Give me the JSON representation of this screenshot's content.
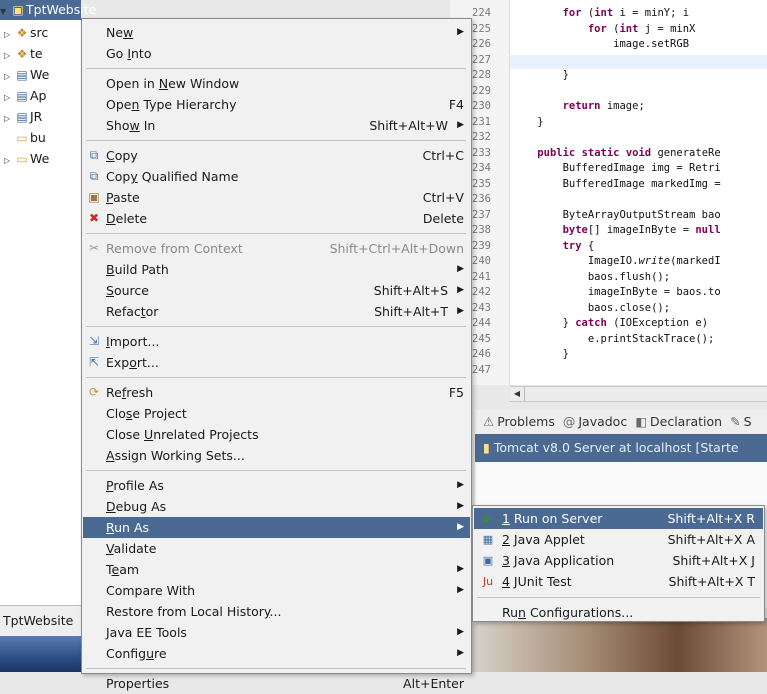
{
  "explorer": {
    "root": "TptWebsite",
    "items": [
      {
        "label": "src",
        "icon": "package-folder-icon"
      },
      {
        "label": "te",
        "icon": "package-folder-icon"
      },
      {
        "label": "We",
        "icon": "library-icon"
      },
      {
        "label": "Ap",
        "icon": "library-icon"
      },
      {
        "label": "JR",
        "icon": "library-icon"
      },
      {
        "label": "bu",
        "icon": "folder-icon"
      },
      {
        "label": "We",
        "icon": "folder-icon"
      }
    ],
    "bottom_label": "TptWebsite"
  },
  "editor": {
    "lines": [
      {
        "n": "224",
        "code": "        for (int i = minY; i"
      },
      {
        "n": "225",
        "code": "            for (int j = minX"
      },
      {
        "n": "226",
        "code": "                image.setRGB"
      },
      {
        "n": "227",
        "code": ""
      },
      {
        "n": "228",
        "code": "        }"
      },
      {
        "n": "229",
        "code": ""
      },
      {
        "n": "230",
        "code": "        return image;"
      },
      {
        "n": "231",
        "code": "    }"
      },
      {
        "n": "232",
        "code": ""
      },
      {
        "n": "233",
        "code": "    public static void generateRe"
      },
      {
        "n": "234",
        "code": "        BufferedImage img = Retri"
      },
      {
        "n": "235",
        "code": "        BufferedImage markedImg ="
      },
      {
        "n": "236",
        "code": ""
      },
      {
        "n": "237",
        "code": "        ByteArrayOutputStream bao"
      },
      {
        "n": "238",
        "code": "        byte[] imageInByte = null"
      },
      {
        "n": "239",
        "code": "        try {"
      },
      {
        "n": "240",
        "code": "            ImageIO.write(markedI"
      },
      {
        "n": "241",
        "code": "            baos.flush();"
      },
      {
        "n": "242",
        "code": "            imageInByte = baos.to"
      },
      {
        "n": "243",
        "code": "            baos.close();"
      },
      {
        "n": "244",
        "code": "        } catch (IOException e)"
      },
      {
        "n": "245",
        "code": "            e.printStackTrace();"
      },
      {
        "n": "246",
        "code": "        }"
      },
      {
        "n": "247",
        "code": ""
      }
    ]
  },
  "views": {
    "tabs": [
      {
        "label": "Problems",
        "icon": "problems-icon"
      },
      {
        "label": "Javadoc",
        "icon": "at-icon"
      },
      {
        "label": "Declaration",
        "icon": "declaration-icon"
      },
      {
        "label": "S",
        "icon": "snippet-icon"
      }
    ],
    "server": "Tomcat v8.0 Server at localhost  [Starte"
  },
  "menu": {
    "items": [
      {
        "label": "New",
        "u": "w",
        "shortcut": "",
        "submenu": true
      },
      {
        "label": "Go Into",
        "u": "I",
        "shortcut": ""
      },
      {
        "sep": true
      },
      {
        "label": "Open in New Window",
        "u": "N",
        "shortcut": ""
      },
      {
        "label": "Open Type Hierarchy",
        "u": "n",
        "shortcut": "F4"
      },
      {
        "label": "Show In",
        "u": "w",
        "shortcut": "Shift+Alt+W",
        "submenu": true
      },
      {
        "sep": true
      },
      {
        "label": "Copy",
        "u": "C",
        "shortcut": "Ctrl+C",
        "icon": "copy-icon"
      },
      {
        "label": "Copy Qualified Name",
        "u": "y",
        "shortcut": "",
        "icon": "copy-qualified-name-icon"
      },
      {
        "label": "Paste",
        "u": "P",
        "shortcut": "Ctrl+V",
        "icon": "paste-icon"
      },
      {
        "label": "Delete",
        "u": "D",
        "shortcut": "Delete",
        "icon": "delete-icon"
      },
      {
        "sep": true
      },
      {
        "label": "Remove from Context",
        "u": "",
        "shortcut": "Shift+Ctrl+Alt+Down",
        "icon": "remove-context-icon",
        "disabled": true
      },
      {
        "label": "Build Path",
        "u": "B",
        "shortcut": "",
        "submenu": true
      },
      {
        "label": "Source",
        "u": "S",
        "shortcut": "Shift+Alt+S",
        "submenu": true
      },
      {
        "label": "Refactor",
        "u": "t",
        "shortcut": "Shift+Alt+T",
        "submenu": true
      },
      {
        "sep": true
      },
      {
        "label": "Import...",
        "u": "I",
        "shortcut": "",
        "icon": "import-icon"
      },
      {
        "label": "Export...",
        "u": "o",
        "shortcut": "",
        "icon": "export-icon"
      },
      {
        "sep": true
      },
      {
        "label": "Refresh",
        "u": "f",
        "shortcut": "F5",
        "icon": "refresh-icon"
      },
      {
        "label": "Close Project",
        "u": "s",
        "shortcut": ""
      },
      {
        "label": "Close Unrelated Projects",
        "u": "U",
        "shortcut": ""
      },
      {
        "label": "Assign Working Sets...",
        "u": "A",
        "shortcut": ""
      },
      {
        "sep": true
      },
      {
        "label": "Profile As",
        "u": "P",
        "shortcut": "",
        "submenu": true
      },
      {
        "label": "Debug As",
        "u": "D",
        "shortcut": "",
        "submenu": true
      },
      {
        "label": "Run As",
        "u": "R",
        "shortcut": "",
        "submenu": true,
        "selected": true
      },
      {
        "label": "Validate",
        "u": "V",
        "shortcut": ""
      },
      {
        "label": "Team",
        "u": "e",
        "shortcut": "",
        "submenu": true
      },
      {
        "label": "Compare With",
        "u": "",
        "shortcut": "",
        "submenu": true
      },
      {
        "label": "Restore from Local History...",
        "u": "y",
        "shortcut": ""
      },
      {
        "label": "Java EE Tools",
        "u": "",
        "shortcut": "",
        "submenu": true
      },
      {
        "label": "Configure",
        "u": "u",
        "shortcut": "",
        "submenu": true
      },
      {
        "sep": true
      },
      {
        "label": "Properties",
        "u": "",
        "shortcut": "Alt+Enter"
      }
    ]
  },
  "submenu": {
    "items": [
      {
        "label": "1 Run on Server",
        "u": "1",
        "shortcut": "Shift+Alt+X R",
        "icon": "run-on-server-icon",
        "selected": true
      },
      {
        "label": "2 Java Applet",
        "u": "2",
        "shortcut": "Shift+Alt+X A",
        "icon": "java-applet-icon"
      },
      {
        "label": "3 Java Application",
        "u": "3",
        "shortcut": "Shift+Alt+X J",
        "icon": "java-application-icon"
      },
      {
        "label": "4 JUnit Test",
        "u": "4",
        "shortcut": "Shift+Alt+X T",
        "icon": "junit-icon"
      },
      {
        "sep": true
      },
      {
        "label": "Run Configurations...",
        "u": "n",
        "shortcut": ""
      }
    ]
  },
  "colors": {
    "selection": "#4a6a94",
    "menu_bg": "#f1f1f1",
    "keyword": "#7f0055"
  }
}
